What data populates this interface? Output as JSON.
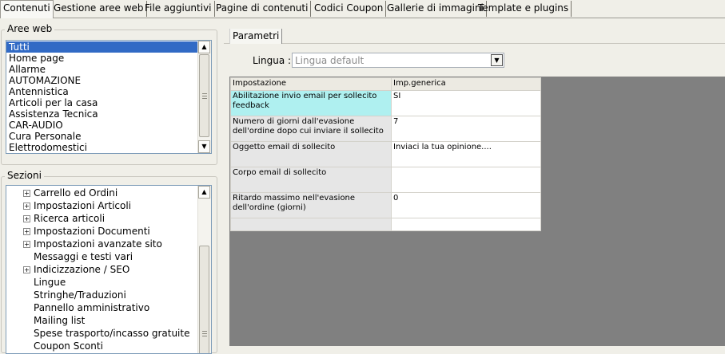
{
  "tabs": [
    {
      "label": "Contenuti",
      "active": true
    },
    {
      "label": "Gestione aree web"
    },
    {
      "label": "File aggiuntivi"
    },
    {
      "label": "Pagine di contenuti"
    },
    {
      "label": "Codici Coupon"
    },
    {
      "label": "Gallerie di immagini"
    },
    {
      "label": "Template e plugins"
    }
  ],
  "aree_web": {
    "legend": "Aree web",
    "items": [
      "Tutti",
      "Home page",
      "Allarme",
      "AUTOMAZIONE",
      "Antennistica",
      "Articoli per la casa",
      "Assistenza Tecnica",
      "CAR-AUDIO",
      "Cura Personale",
      "Elettrodomestici"
    ],
    "selected_index": 0
  },
  "sezioni": {
    "legend": "Sezioni",
    "items": [
      {
        "label": "Carrello ed Ordini",
        "expandable": true
      },
      {
        "label": "Impostazioni Articoli",
        "expandable": true
      },
      {
        "label": "Ricerca articoli",
        "expandable": true
      },
      {
        "label": "Impostazioni Documenti",
        "expandable": true
      },
      {
        "label": "Impostazioni avanzate sito",
        "expandable": true
      },
      {
        "label": "Messaggi e testi vari",
        "expandable": false
      },
      {
        "label": "Indicizzazione / SEO",
        "expandable": true
      },
      {
        "label": "Lingue",
        "expandable": false
      },
      {
        "label": "Stringhe/Traduzioni",
        "expandable": false
      },
      {
        "label": "Pannello amministrativo",
        "expandable": false
      },
      {
        "label": "Mailing list",
        "expandable": false
      },
      {
        "label": "Spese trasporto/incasso gratuite",
        "expandable": false
      },
      {
        "label": "Coupon Sconti",
        "expandable": false
      }
    ]
  },
  "parametri": {
    "tab_label": "Parametri",
    "lingua_label": "Lingua :",
    "lingua_value": "Lingua default",
    "grid": {
      "headers": [
        "Impostazione",
        "Imp.generica"
      ],
      "rows": [
        {
          "key": "Abilitazione invio email per sollecito feedback",
          "value": "SI",
          "highlight": true
        },
        {
          "key": "Numero di giorni dall'evasione dell'ordine dopo cui inviare il sollecito",
          "value": "7"
        },
        {
          "key": "Oggetto email di sollecito",
          "value": "Inviaci la tua opinione...."
        },
        {
          "key": "Corpo email di sollecito",
          "value": ""
        },
        {
          "key": "Ritardo massimo nell'evasione dell'ordine (giorni)",
          "value": "0"
        },
        {
          "key": "",
          "value": ""
        }
      ]
    }
  },
  "colors": {
    "selection": "#316ac5",
    "highlight_row": "#aff0f0",
    "grid_background": "#808080"
  }
}
